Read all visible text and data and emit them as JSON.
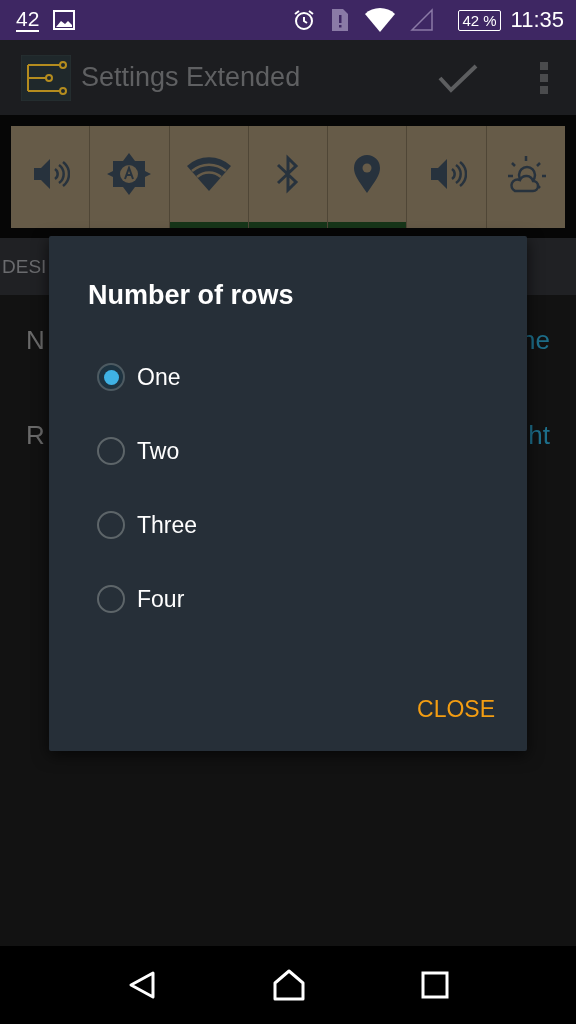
{
  "status_bar": {
    "notification_count": "42",
    "battery": "42 %",
    "time": "11:35"
  },
  "app_bar": {
    "title": "Settings Extended"
  },
  "tiles": [
    {
      "kind": "volume",
      "on": false
    },
    {
      "kind": "brightness",
      "on": false
    },
    {
      "kind": "wifi",
      "on": true
    },
    {
      "kind": "bluetooth",
      "on": true
    },
    {
      "kind": "location",
      "on": true
    },
    {
      "kind": "volume",
      "on": false
    },
    {
      "kind": "weather",
      "on": false
    }
  ],
  "tab": {
    "label": "DESI"
  },
  "settings": [
    {
      "label": "N",
      "value": "ne"
    },
    {
      "label": "R",
      "value": "ht"
    }
  ],
  "dialog": {
    "title": "Number of rows",
    "options": [
      {
        "label": "One",
        "selected": true
      },
      {
        "label": "Two",
        "selected": false
      },
      {
        "label": "Three",
        "selected": false
      },
      {
        "label": "Four",
        "selected": false
      }
    ],
    "button": "CLOSE"
  }
}
